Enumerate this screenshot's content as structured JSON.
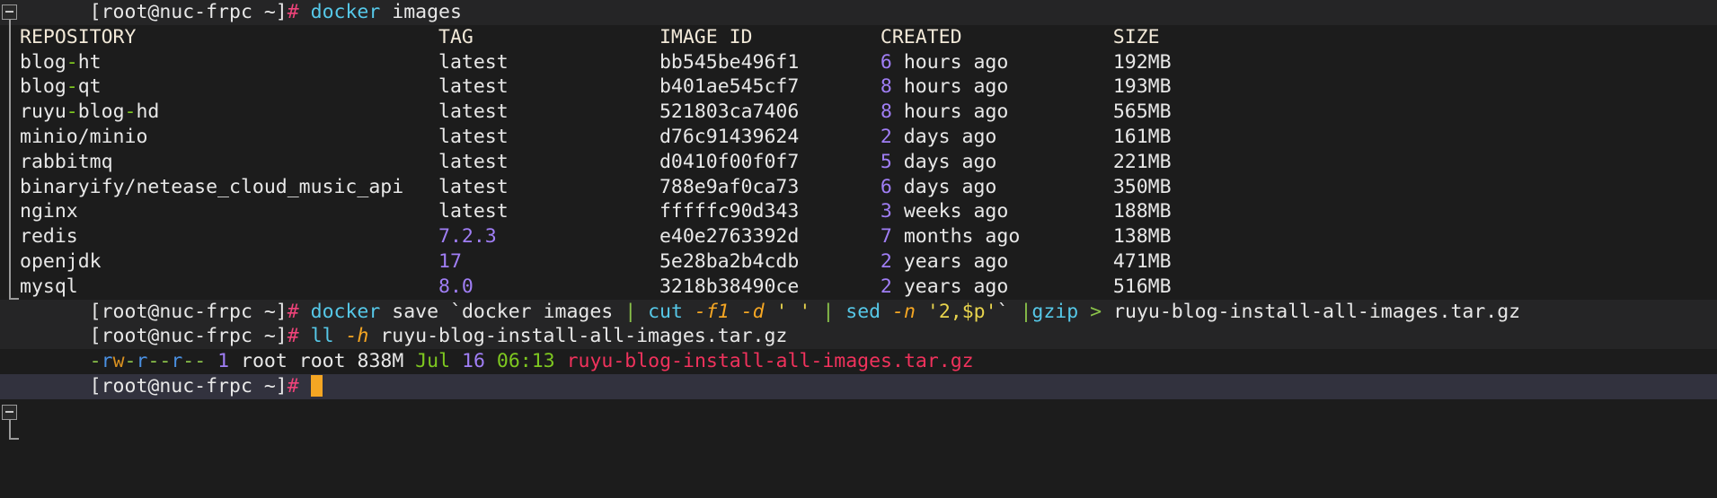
{
  "terminal": {
    "prompt": "[root@nuc-frpc ~]",
    "prompt_symbol": "#",
    "colors": {
      "background": "#1c1c1c",
      "command_line_bg": "#252526",
      "current_line_bg": "#32323e",
      "prompt_text": "#e8e8e8",
      "prompt_hash": "#f0437a",
      "command": "#56c8e8",
      "flag": "#f5a623",
      "string": "#e8d44d",
      "pipe": "#8bc34a",
      "number": "#9e71f0",
      "header": "#f2e9d8",
      "archive_file": "#f0325c",
      "cursor": "#f5a623"
    }
  },
  "command_1": {
    "program": "docker",
    "args": "images"
  },
  "docker_images": {
    "headers": [
      "REPOSITORY",
      "TAG",
      "IMAGE ID",
      "CREATED",
      "SIZE"
    ],
    "rows": [
      {
        "repository": "blog-ht",
        "tag": "latest",
        "tag_is_version": false,
        "image_id": "bb545be496f1",
        "created_num": "6",
        "created_unit": "hours ago",
        "size": "192MB"
      },
      {
        "repository": "blog-qt",
        "tag": "latest",
        "tag_is_version": false,
        "image_id": "b401ae545cf7",
        "created_num": "8",
        "created_unit": "hours ago",
        "size": "193MB"
      },
      {
        "repository": "ruyu-blog-hd",
        "tag": "latest",
        "tag_is_version": false,
        "image_id": "521803ca7406",
        "created_num": "8",
        "created_unit": "hours ago",
        "size": "565MB"
      },
      {
        "repository": "minio/minio",
        "tag": "latest",
        "tag_is_version": false,
        "image_id": "d76c91439624",
        "created_num": "2",
        "created_unit": "days ago",
        "size": "161MB"
      },
      {
        "repository": "rabbitmq",
        "tag": "latest",
        "tag_is_version": false,
        "image_id": "d0410f00f0f7",
        "created_num": "5",
        "created_unit": "days ago",
        "size": "221MB"
      },
      {
        "repository": "binaryify/netease_cloud_music_api",
        "tag": "latest",
        "tag_is_version": false,
        "image_id": "788e9af0ca73",
        "created_num": "6",
        "created_unit": "days ago",
        "size": "350MB"
      },
      {
        "repository": "nginx",
        "tag": "latest",
        "tag_is_version": false,
        "image_id": "fffffc90d343",
        "created_num": "3",
        "created_unit": "weeks ago",
        "size": "188MB"
      },
      {
        "repository": "redis",
        "tag": "7.2.3",
        "tag_is_version": true,
        "image_id": "e40e2763392d",
        "created_num": "7",
        "created_unit": "months ago",
        "size": "138MB"
      },
      {
        "repository": "openjdk",
        "tag": "17",
        "tag_is_version": true,
        "image_id": "5e28ba2b4cdb",
        "created_num": "2",
        "created_unit": "years ago",
        "size": "471MB"
      },
      {
        "repository": "mysql",
        "tag": "8.0",
        "tag_is_version": true,
        "image_id": "3218b38490ce",
        "created_num": "2",
        "created_unit": "years ago",
        "size": "516MB"
      }
    ]
  },
  "command_2": {
    "tok_docker": "docker",
    "tok_save": "save",
    "tok_backtick_open": "`",
    "tok_docker2": "docker",
    "tok_images": "images",
    "tok_pipe1": "|",
    "tok_cut": "cut",
    "tok_f1": "-f1",
    "tok_d": "-d",
    "tok_sep": "' '",
    "tok_pipe2": "|",
    "tok_sed": "sed",
    "tok_n": "-n",
    "tok_range": "'2,$p'",
    "tok_backtick_close": "`",
    "tok_pipe3": "|",
    "tok_gzip": "gzip",
    "tok_redirect": ">",
    "tok_outfile": "ruyu-blog-install-all-images.tar.gz"
  },
  "command_3": {
    "program": "ll",
    "flag": "-h",
    "target": "ruyu-blog-install-all-images.tar.gz"
  },
  "ls_output": {
    "perm_type": "-",
    "perm_rw": "rw",
    "perm_dash1": "-",
    "perm_r2": "r",
    "perm_dash2": "--",
    "perm_r3": "r",
    "perm_dash3": "--",
    "links": "1",
    "owner": "root",
    "group": "root",
    "size": "838M",
    "month": "Jul",
    "day": "16",
    "time": "06:13",
    "filename": "ruyu-blog-install-all-images.tar.gz"
  }
}
